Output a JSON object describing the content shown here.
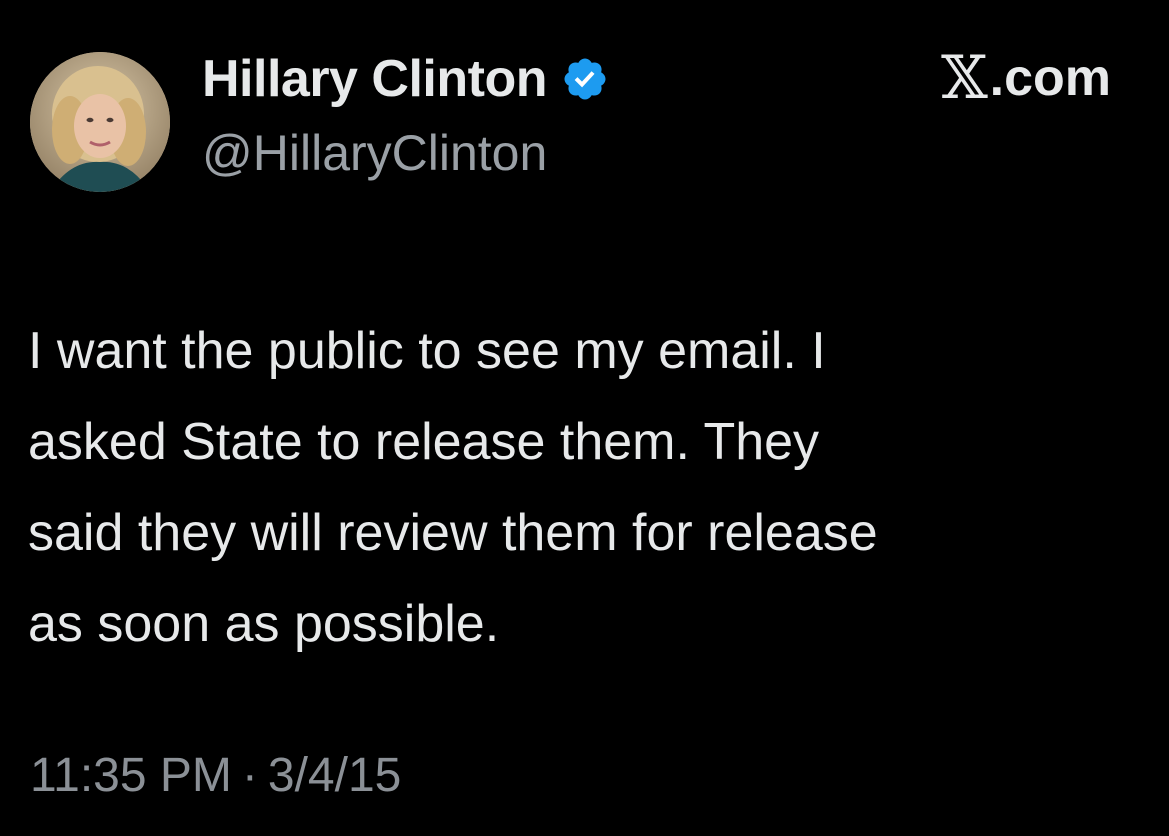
{
  "author": {
    "display_name": "Hillary Clinton",
    "handle": "@HillaryClinton",
    "verified": true,
    "verified_color": "#1d9bf0",
    "avatar_icon": "profile-photo"
  },
  "site": {
    "label_suffix": ".com",
    "logo_glyph": "𝕏"
  },
  "tweet": {
    "text": "I want the public to see my email. I\nasked State to release them. They\nsaid they will review them for release\nas soon as possible.",
    "time": "11:35 PM",
    "separator": "·",
    "date": "3/4/15"
  },
  "colors": {
    "background": "#000000",
    "primary_text": "#e7e9ea",
    "secondary_text": "#8b9096"
  }
}
